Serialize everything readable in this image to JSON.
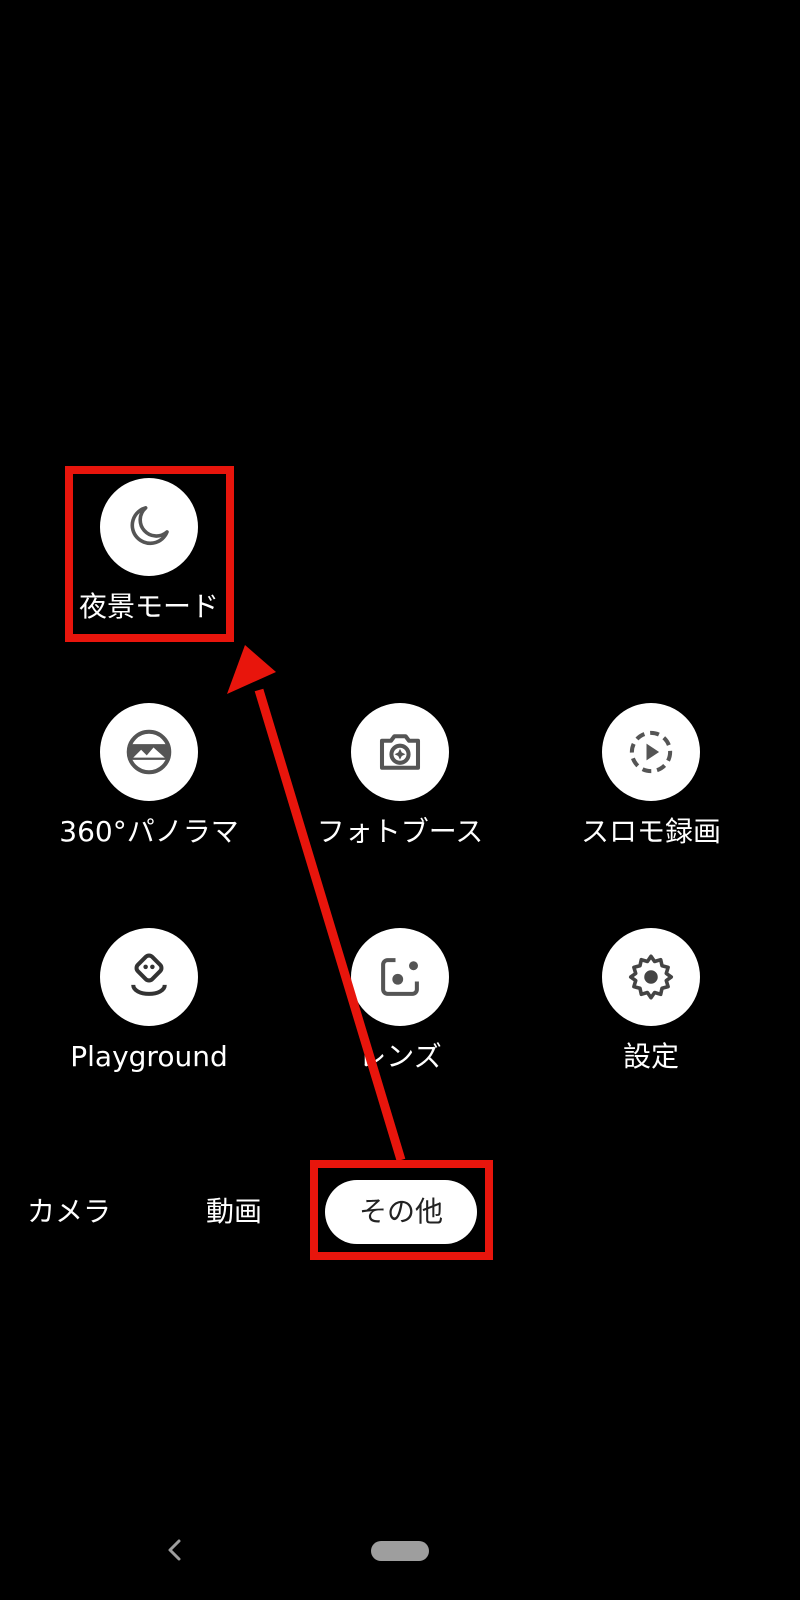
{
  "modes": [
    {
      "label": "夜景モード",
      "icon": "moon-icon"
    },
    {
      "label": "360°パノラマ",
      "icon": "panorama-360-icon"
    },
    {
      "label": "フォトブース",
      "icon": "photobooth-icon"
    },
    {
      "label": "スロモ録画",
      "icon": "slow-motion-icon"
    },
    {
      "label": "Playground",
      "icon": "playground-icon"
    },
    {
      "label": "レンズ",
      "icon": "lens-icon"
    },
    {
      "label": "設定",
      "icon": "gear-icon"
    }
  ],
  "tabs": {
    "camera": "カメラ",
    "video": "動画",
    "more": "その他"
  },
  "nav": {
    "back_icon": "back-chevron-icon",
    "home_icon": "home-pill-icon"
  },
  "annotation_color": "#e8150c"
}
